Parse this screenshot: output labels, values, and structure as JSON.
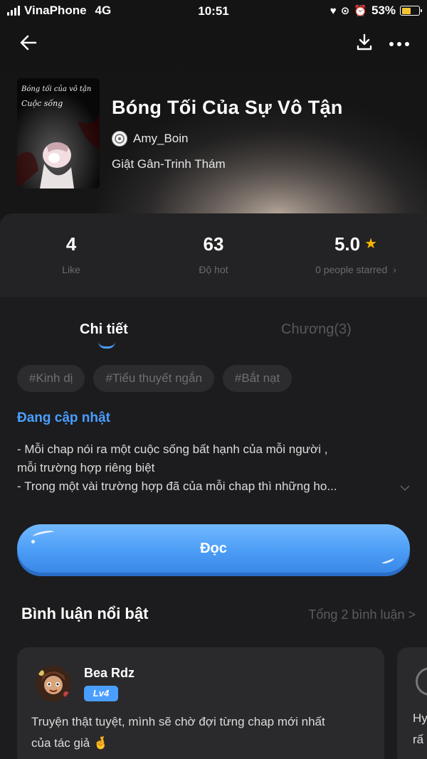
{
  "status_bar": {
    "carrier": "VinaPhone",
    "network": "4G",
    "time": "10:51",
    "battery": "53%",
    "battery_level": 0.53,
    "battery_color": "#f4c430"
  },
  "nav": {
    "back_icon": "arrow-left-icon",
    "download_icon": "download-icon",
    "more_icon": "more-horizontal-icon"
  },
  "book": {
    "cover_text_1": "Bóng tối của vô tận",
    "cover_text_2": "Cuộc sống",
    "title": "Bóng Tối Của Sự Vô Tận",
    "author": "Amy_Boin",
    "genre": "Giật Gân-Trinh Thám"
  },
  "stats": {
    "likes": "4",
    "likes_label": "Like",
    "hot": "63",
    "hot_label": "Độ hot",
    "rating": "5.0",
    "rating_label": "0 people starred",
    "star_color": "#f7b500"
  },
  "tabs": {
    "details": "Chi tiết",
    "chapters": "Chương(3)"
  },
  "tags": [
    "#Kinh dị",
    "#Tiểu thuyết ngắn",
    "#Bắt nạt"
  ],
  "description": {
    "status": "Đang cập nhật",
    "line1": "- Mỗi chap nói ra một cuộc sống bất hạnh của mỗi người ,",
    "line2": "mỗi trường hợp riêng biệt",
    "line3": "- Trong một vài trường hợp đã của mỗi chap thì những ho..."
  },
  "read_button": "Đọc",
  "comments": {
    "heading": "Bình luận nổi bật",
    "total": "Tổng 2 bình luận >",
    "items": [
      {
        "user": "Bea Rdz",
        "level": "Lv4",
        "text_line1": "Truyện thật tuyệt, mình sẽ chờ đợi từng chap mới nhất",
        "text_line2": "của tác giả 🤞"
      },
      {
        "text_line1": "Hy",
        "text_line2": "rấ"
      }
    ]
  },
  "colors": {
    "accent": "#4a9eff",
    "background": "#1c1c1e",
    "card": "#2a2a2c"
  }
}
